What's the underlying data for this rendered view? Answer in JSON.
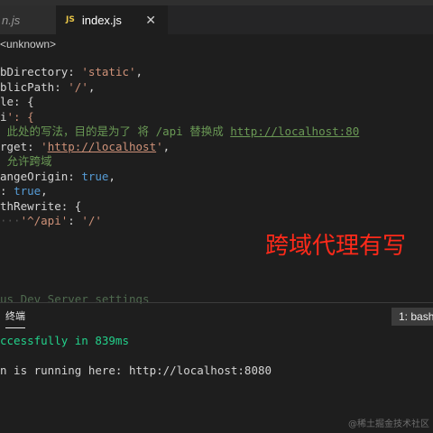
{
  "tabs": [
    {
      "label": "n.js"
    },
    {
      "label": "index.js",
      "icon": "JS",
      "close": "✕"
    }
  ],
  "breadcrumb": "<unknown>",
  "code_lines": [
    {
      "parts": [
        {
          "t": "bDirectory: ",
          "c": ""
        },
        {
          "t": "'static'",
          "c": "str"
        },
        {
          "t": ",",
          "c": ""
        }
      ]
    },
    {
      "parts": [
        {
          "t": "blicPath: ",
          "c": ""
        },
        {
          "t": "'/'",
          "c": "str"
        },
        {
          "t": ",",
          "c": ""
        }
      ]
    },
    {
      "parts": [
        {
          "t": "le: {",
          "c": ""
        }
      ]
    },
    {
      "parts": [
        {
          "t": "i",
          "c": ""
        },
        {
          "t": "': {",
          "c": "str"
        }
      ]
    },
    {
      "parts": [
        {
          "t": " 此处的写法，目的是为了 将 /api 替换成 ",
          "c": "cmt"
        },
        {
          "t": "http://localhost:80",
          "c": "url"
        }
      ]
    },
    {
      "parts": [
        {
          "t": "rget: ",
          "c": ""
        },
        {
          "t": "'",
          "c": "str"
        },
        {
          "t": "http://localhost",
          "c": "urls"
        },
        {
          "t": "'",
          "c": "str"
        },
        {
          "t": ",",
          "c": ""
        }
      ]
    },
    {
      "parts": [
        {
          "t": " 允许跨域",
          "c": "cmt"
        }
      ]
    },
    {
      "parts": [
        {
          "t": "angeOrigin: ",
          "c": ""
        },
        {
          "t": "true",
          "c": "kw"
        },
        {
          "t": ",",
          "c": ""
        }
      ]
    },
    {
      "parts": [
        {
          "t": ": ",
          "c": ""
        },
        {
          "t": "true",
          "c": "kw"
        },
        {
          "t": ",",
          "c": ""
        }
      ]
    },
    {
      "parts": [
        {
          "t": "thRewrite: {",
          "c": ""
        }
      ]
    },
    {
      "parts": [
        {
          "t": "···",
          "c": "ind"
        },
        {
          "t": "'^/api'",
          "c": "str"
        },
        {
          "t": ": ",
          "c": ""
        },
        {
          "t": "'/'",
          "c": "str"
        }
      ]
    }
  ],
  "annotation": "跨域代理有写",
  "faded_line": "us Dev Server settings",
  "panel": {
    "tab": "终端",
    "shell": "1: bash"
  },
  "terminal": [
    {
      "text": "ccessfully in 839ms",
      "c": "ok"
    },
    {
      "text": "",
      "c": ""
    },
    {
      "text": "n is running here: http://localhost:8080",
      "c": ""
    }
  ],
  "watermark": "@稀土掘金技术社区",
  "colors": {
    "annotation": "#ff2a1a",
    "string": "#ce9178",
    "comment": "#6a9955",
    "keyword": "#569cd6",
    "success": "#23d18b"
  }
}
